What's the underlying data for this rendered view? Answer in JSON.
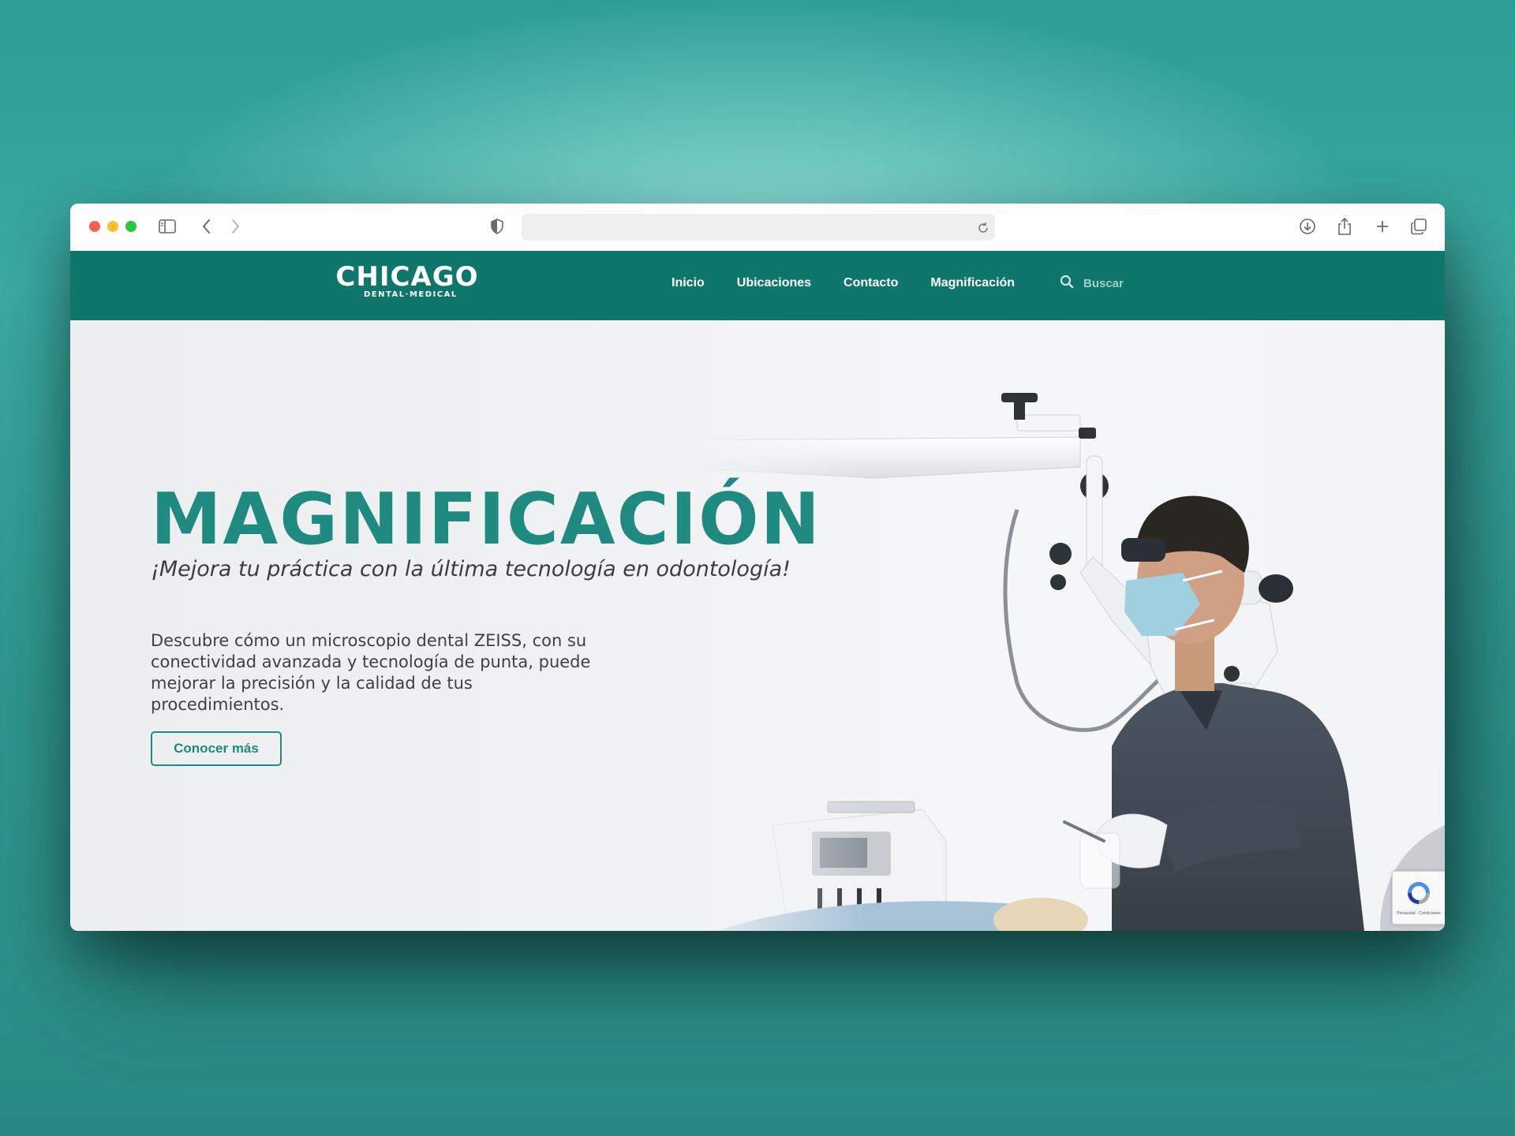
{
  "browser": {
    "address_url": "",
    "icons": [
      "sidebar-icon",
      "back-icon",
      "forward-icon",
      "shield-icon",
      "reload-icon",
      "download-icon",
      "share-icon",
      "new-tab-icon",
      "tabs-overview-icon"
    ]
  },
  "site": {
    "logo": {
      "name": "CHICAGO",
      "tagline": "DENTAL·MEDICAL"
    },
    "nav": {
      "links": [
        {
          "label": "Inicio"
        },
        {
          "label": "Ubicaciones"
        },
        {
          "label": "Contacto"
        },
        {
          "label": "Magnificación"
        }
      ],
      "search_label": "Buscar"
    },
    "hero": {
      "title": "MAGNIFICACIÓN",
      "subtitle": "¡Mejora tu práctica con la última tecnología en odontología!",
      "description": "Descubre cómo un microscopio dental ZEISS, con su conectividad avanzada y tecnología de punta, puede mejorar la precisión y la calidad de tus procedimientos.",
      "cta_label": "Conocer más"
    },
    "recaptcha_text": "Privacidad - Condiciones"
  },
  "colors": {
    "brand_teal": "#0f766c",
    "accent_teal": "#1e8a80",
    "background_teal": "#2d9e95"
  }
}
